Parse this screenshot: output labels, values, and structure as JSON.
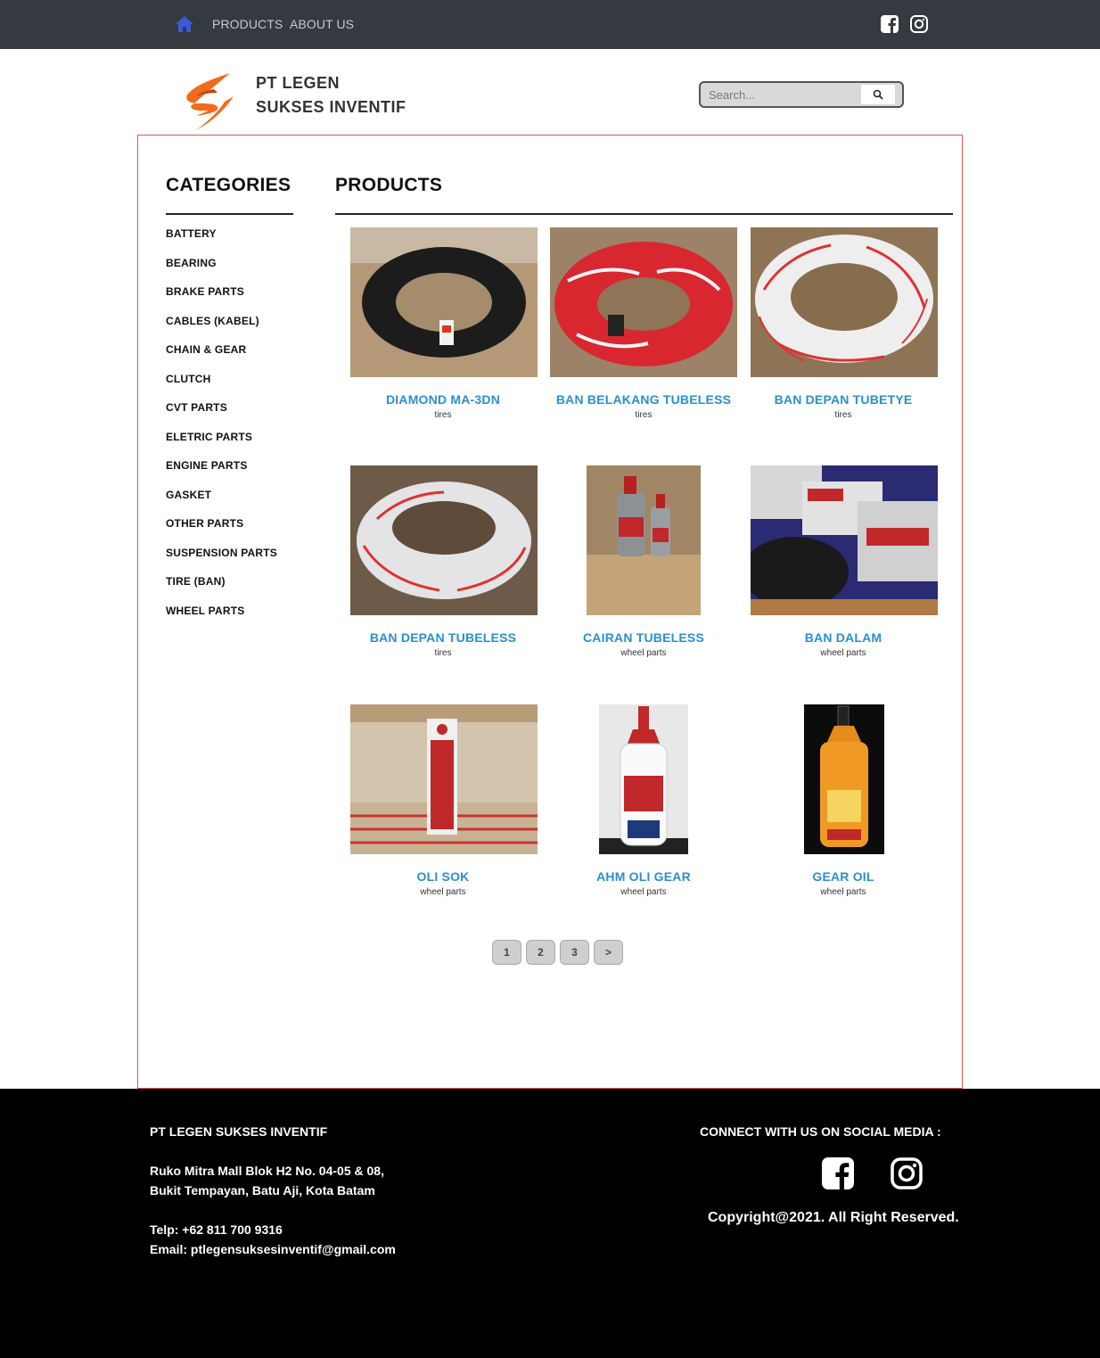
{
  "nav": {
    "home_icon": "home-icon",
    "links": [
      "PRODUCTS",
      "ABOUT US"
    ],
    "social_icons": [
      "facebook-icon",
      "instagram-icon"
    ]
  },
  "header": {
    "brand_line1": "PT LEGEN",
    "brand_line2": "SUKSES INVENTIF",
    "search_placeholder": "Search...",
    "search_icon": "search-icon"
  },
  "sidebar": {
    "title": "CATEGORIES",
    "items": [
      "BATTERY",
      "BEARING",
      "BRAKE PARTS",
      "CABLES (KABEL)",
      "CHAIN & GEAR",
      "CLUTCH",
      "CVT PARTS",
      "ELETRIC PARTS",
      "ENGINE PARTS",
      "GASKET",
      "OTHER PARTS",
      "SUSPENSION PARTS",
      "TIRE (BAN)",
      "WHEEL PARTS"
    ]
  },
  "products": {
    "title": "PRODUCTS",
    "items": [
      {
        "name": "DIAMOND MA-3DN",
        "category": "tires"
      },
      {
        "name": "BAN BELAKANG TUBELESS",
        "category": "tires"
      },
      {
        "name": "BAN DEPAN TUBETYE",
        "category": "tires"
      },
      {
        "name": "BAN DEPAN TUBELESS",
        "category": "tires"
      },
      {
        "name": "CAIRAN TUBELESS",
        "category": "wheel parts"
      },
      {
        "name": "BAN DALAM",
        "category": "wheel parts"
      },
      {
        "name": "OLI SOK",
        "category": "wheel parts"
      },
      {
        "name": "AHM OLI GEAR",
        "category": "wheel parts"
      },
      {
        "name": "GEAR OIL",
        "category": "wheel parts"
      }
    ]
  },
  "pagination": [
    "1",
    "2",
    "3",
    ">"
  ],
  "footer": {
    "company": "PT LEGEN SUKSES INVENTIF",
    "address_line1": "Ruko Mitra Mall Blok H2 No. 04-05 & 08,",
    "address_line2": "Bukit Tempayan, Batu Aji, Kota Batam",
    "telp": "Telp: +62 811 700 9316",
    "email": "Email: ptlegensuksesinventif@gmail.com",
    "connect": "CONNECT WITH US ON SOCIAL MEDIA :",
    "copyright": "Copyright@2021. All Right Reserved."
  },
  "colors": {
    "nav_bg": "#343a40",
    "home_icon": "#3b5bdb",
    "product_name": "#2a8fd0",
    "frame_border": "#e05555",
    "footer_bg": "#000000",
    "logo_orange": "#f26a1b"
  }
}
